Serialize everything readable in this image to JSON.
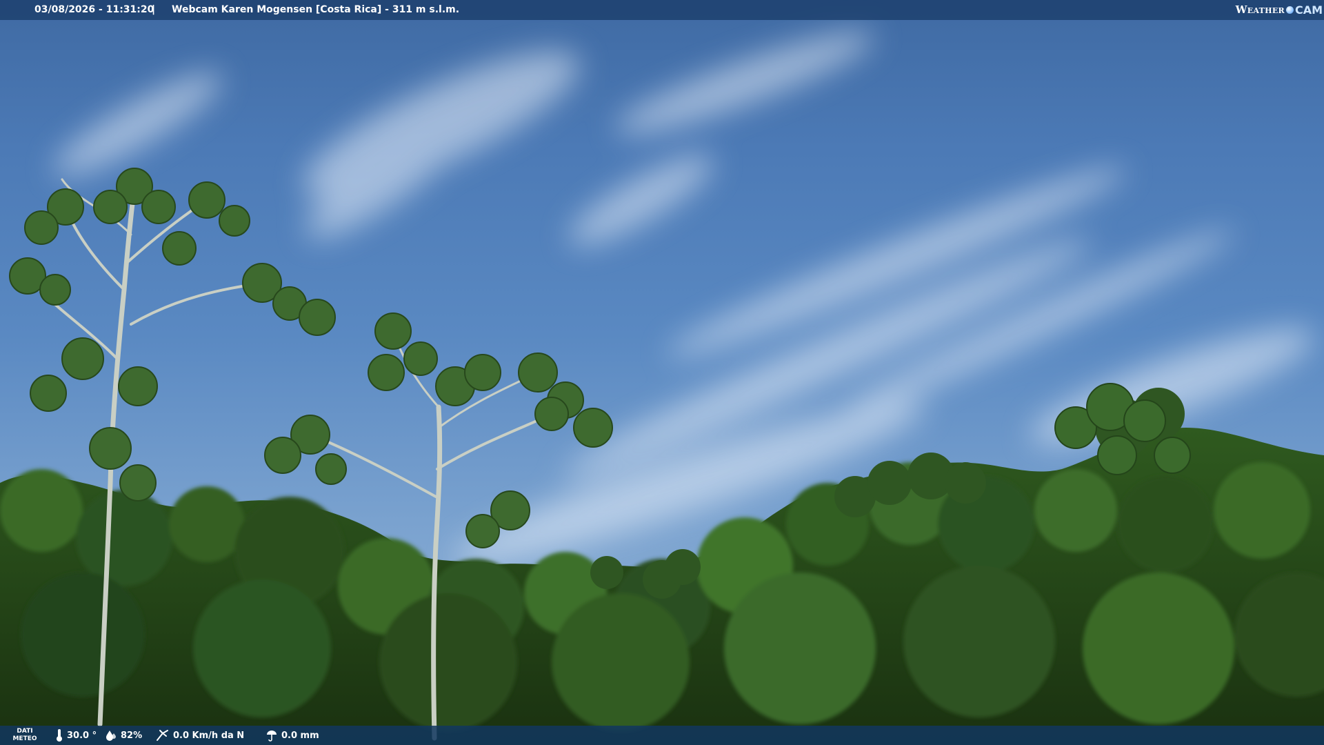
{
  "overlay": {
    "datetime": "03/08/2026 - 11:31:20",
    "separator": "|",
    "camera_title": "Webcam Karen Mogensen [Costa Rica] - 311 m s.l.m.",
    "brand_left": "Weather",
    "brand_right": "CAM"
  },
  "meteo": {
    "label_line1": "DATI",
    "label_line2": "METEO",
    "temperature": "30.0 °",
    "humidity": "82%",
    "wind": "0.0 Km/h da N",
    "rain": "0.0 mm"
  },
  "colors": {
    "sky_top": "#3f6aa3",
    "sky_bottom": "#9bbad9",
    "foliage_dark": "#1f3a14",
    "foliage_mid": "#2f5a1f",
    "foliage_light": "#4d7d34",
    "bar": "#1a3c69"
  },
  "icons": [
    "thermometer-icon",
    "humidity-drop-icon",
    "wind-icon",
    "rain-icon",
    "weathercam-globe-icon"
  ]
}
